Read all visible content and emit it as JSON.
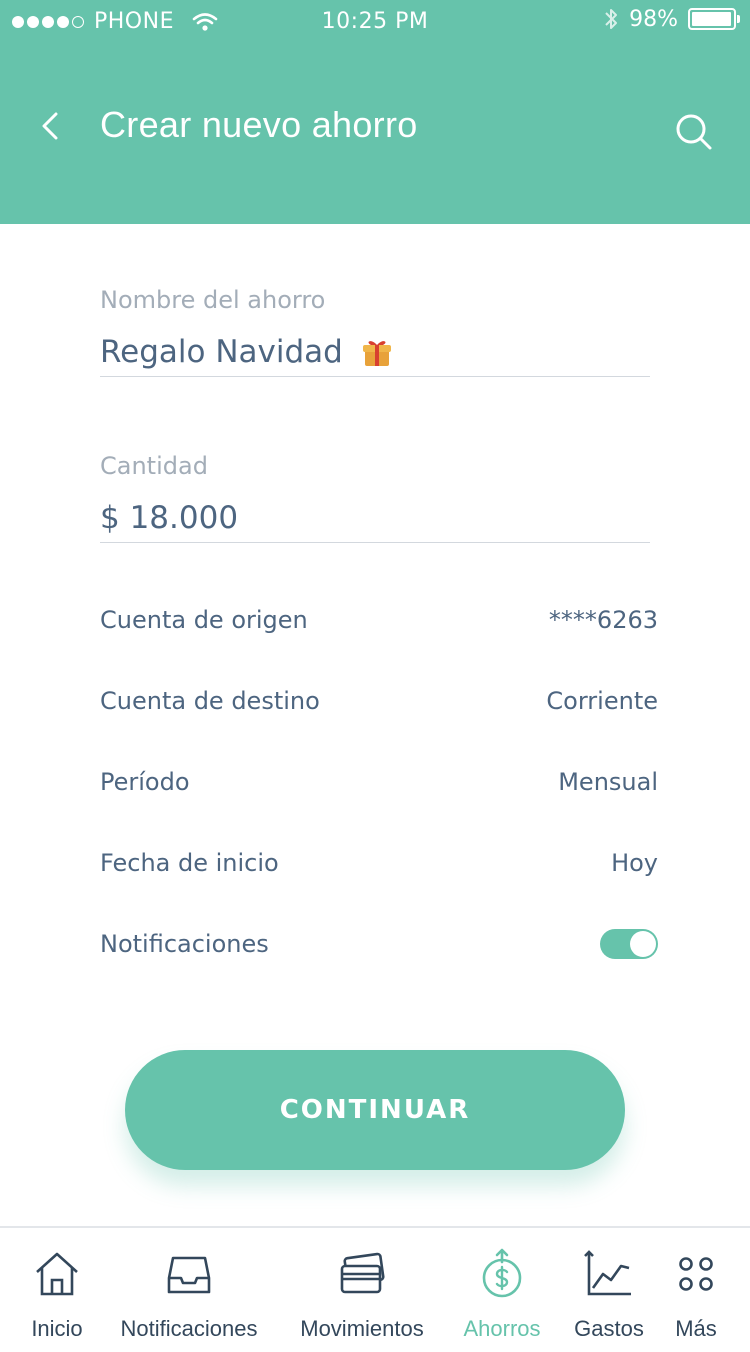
{
  "status_bar": {
    "carrier": "PHONE",
    "time": "10:25 PM",
    "battery": "98%"
  },
  "header": {
    "title": "Crear nuevo ahorro"
  },
  "form": {
    "name_label": "Nombre del ahorro",
    "name_value": "Regalo Navidad",
    "amount_label": "Cantidad",
    "amount_value": "$ 18.000"
  },
  "details": [
    {
      "label": "Cuenta de origen",
      "value": "****6263"
    },
    {
      "label": "Cuenta de destino",
      "value": "Corriente"
    },
    {
      "label": "Período",
      "value": "Mensual"
    },
    {
      "label": "Fecha de inicio",
      "value": "Hoy"
    }
  ],
  "notifications": {
    "label": "Notificaciones",
    "enabled": true
  },
  "continue_label": "CONTINUAR",
  "tabbar": {
    "items": [
      {
        "label": "Inicio",
        "icon": "home-icon"
      },
      {
        "label": "Notificaciones",
        "icon": "inbox-icon"
      },
      {
        "label": "Movimientos",
        "icon": "cards-icon"
      },
      {
        "label": "Ahorros",
        "icon": "savings-icon",
        "active": true
      },
      {
        "label": "Gastos",
        "icon": "chart-icon"
      },
      {
        "label": "Más",
        "icon": "more-icon"
      }
    ]
  },
  "colors": {
    "accent": "#66c3ab",
    "text": "#4d6580",
    "label": "#a3adb8"
  }
}
